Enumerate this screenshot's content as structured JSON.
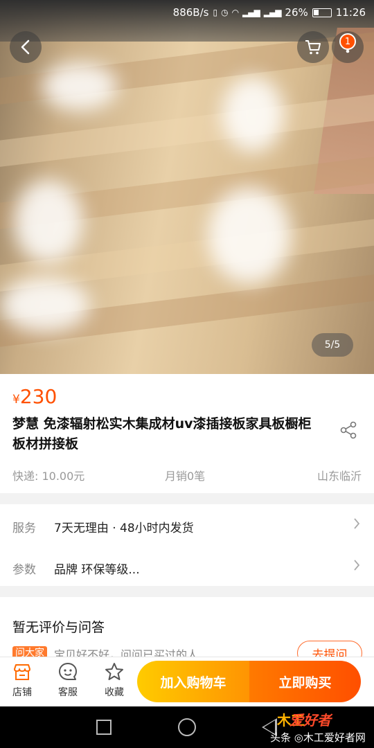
{
  "status_bar": {
    "speed": "886B/s",
    "battery": "26%",
    "time": "11:26"
  },
  "header": {
    "cart_badge": "1"
  },
  "gallery": {
    "pager": "5/5"
  },
  "product": {
    "currency": "¥",
    "price": "230",
    "title": "梦慧 免漆辐射松实木集成材uv漆插接板家具板橱柜板材拼接板",
    "shipping": "快递: 10.00元",
    "monthly_sales": "月销0笔",
    "location": "山东临沂"
  },
  "service": {
    "label": "服务",
    "value": "7天无理由 · 48小时内发货"
  },
  "params": {
    "label": "参数",
    "value": "品牌 环保等级..."
  },
  "reviews": {
    "title": "暂无评价与问答",
    "ask_tag": "问大家",
    "ask_text": "宝贝好不好，问问已买过的人",
    "ask_button": "去提问"
  },
  "toolbar": {
    "shop": "店铺",
    "service": "客服",
    "favorite": "收藏",
    "add_to_cart": "加入购物车",
    "buy_now": "立即购买"
  },
  "watermark": {
    "logo": "木工",
    "brand": "爱好者",
    "text": "头条 ◎木工爱好者网"
  },
  "colors": {
    "accent": "#ff5000",
    "cart_gradient": [
      "#ffcb00",
      "#ff9402"
    ],
    "buy_gradient": [
      "#ff7a00",
      "#ff4f00"
    ]
  }
}
